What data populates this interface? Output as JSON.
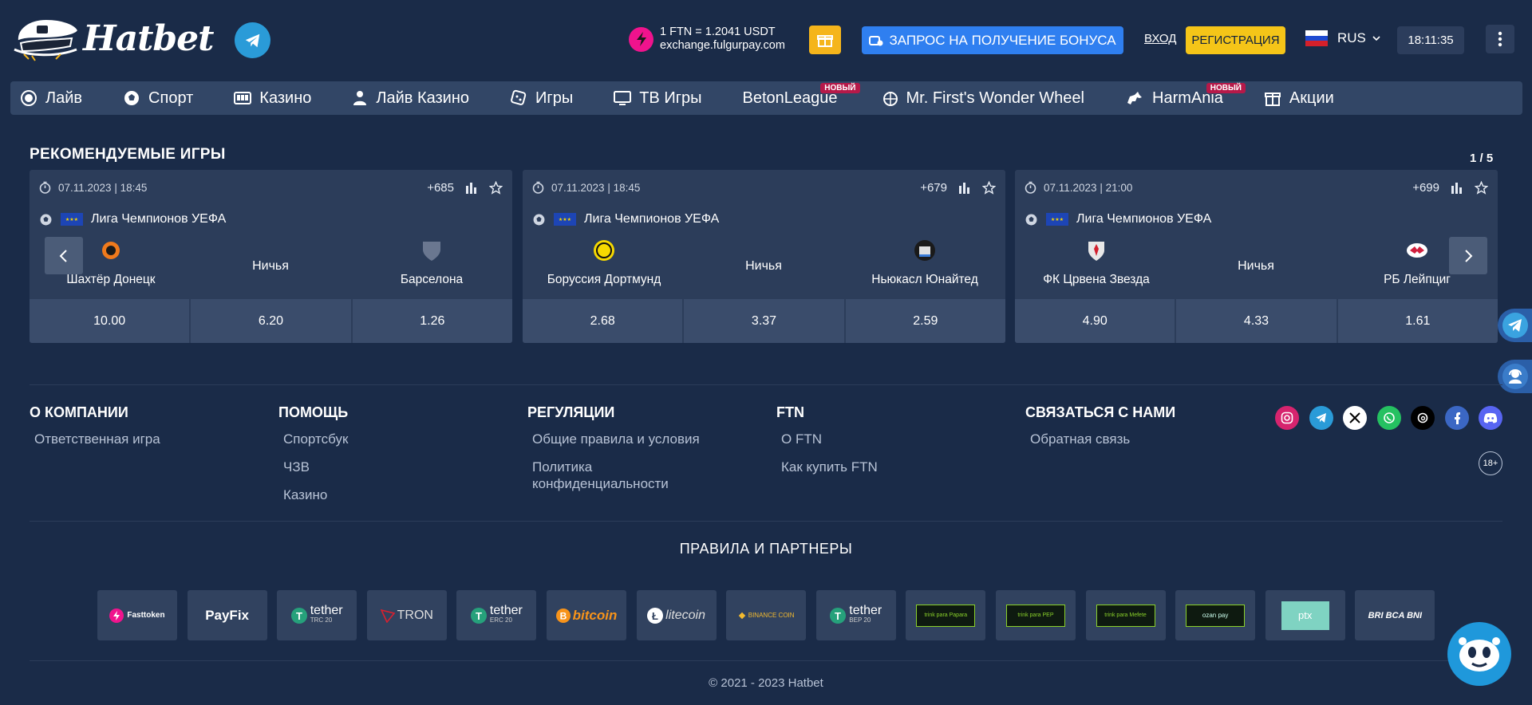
{
  "header": {
    "brand": "Hatbet",
    "exchange_rate": "1 FTN = 1.2041 USDT",
    "exchange_site": "exchange.fulgurpay.com",
    "bonus_label": "ЗАПРОС НА ПОЛУЧЕНИЕ БОНУСА",
    "login_label": "ВХОД",
    "register_label": "РЕГИСТРАЦИЯ",
    "language": "RUS",
    "time": "18:11:35"
  },
  "nav": {
    "items": [
      {
        "label": "Лайв",
        "icon": "live-icon"
      },
      {
        "label": "Спорт",
        "icon": "soccer-ball-icon"
      },
      {
        "label": "Казино",
        "icon": "slot-machine-icon"
      },
      {
        "label": "Лайв Казино",
        "icon": "dealer-icon"
      },
      {
        "label": "Игры",
        "icon": "dice-icon"
      },
      {
        "label": "ТВ Игры",
        "icon": "tv-icon"
      },
      {
        "label": "BetonLeague",
        "badge": "НОВЫЙ"
      },
      {
        "label": "Mr. First's Wonder Wheel",
        "icon": "wheel-icon"
      },
      {
        "label": "HarmAnia",
        "badge": "НОВЫЙ",
        "icon": "horse-icon"
      },
      {
        "label": "Акции",
        "icon": "gift-icon"
      }
    ]
  },
  "featured": {
    "title": "РЕКОМЕНДУЕМЫЕ ИГРЫ",
    "pager": "1 / 5",
    "cards": [
      {
        "date": "07.11.2023 | 18:45",
        "count": "+685",
        "league": "Лига Чемпионов УЕФА",
        "home": "Шахтёр Донецк",
        "draw": "Ничья",
        "away": "Барселона",
        "odds": [
          "10.00",
          "6.20",
          "1.26"
        ]
      },
      {
        "date": "07.11.2023 | 18:45",
        "count": "+679",
        "league": "Лига Чемпионов УЕФА",
        "home": "Боруссия Дортмунд",
        "draw": "Ничья",
        "away": "Ньюкасл Юнайтед",
        "odds": [
          "2.68",
          "3.37",
          "2.59"
        ]
      },
      {
        "date": "07.11.2023 | 21:00",
        "count": "+699",
        "league": "Лига Чемпионов УЕФА",
        "home": "ФК Црвена Звезда",
        "draw": "Ничья",
        "away": "РБ Лейпциг",
        "odds": [
          "4.90",
          "4.33",
          "1.61"
        ]
      }
    ]
  },
  "footer": {
    "company": {
      "title": "О КОМПАНИИ",
      "links": [
        "Ответственная игра"
      ]
    },
    "help": {
      "title": "ПОМОЩЬ",
      "links": [
        "Спортсбук",
        "ЧЗВ",
        "Казино"
      ]
    },
    "regulations": {
      "title": "РЕГУЛЯЦИИ",
      "links": [
        "Общие правила и условия",
        "Политика конфиденциальности"
      ]
    },
    "ftn": {
      "title": "FTN",
      "links": [
        "О FTN",
        "Как купить FTN"
      ]
    },
    "contact": {
      "title": "СВЯЗАТЬСЯ С НАМИ",
      "links": [
        "Обратная связь"
      ]
    },
    "age": "18+",
    "partners_title": "ПРАВИЛА И ПАРТНЕРЫ",
    "partners": [
      "Fasttoken",
      "PayFix",
      "tether",
      "TRON",
      "tether",
      "bitcoin",
      "litecoin",
      "BINANCE COIN",
      "tether",
      "trink para Papara",
      "trink para PEP",
      "trink para Mefete",
      "ozan pay",
      "ptx",
      "BRI BCA BNI"
    ],
    "partner_subs": {
      "tether_trc": "TRC 20",
      "tether_erc": "ERC 20",
      "tether_bep": "BEP 20"
    },
    "copyright": "© 2021 - 2023 Hatbet"
  },
  "colors": {
    "accent_blue": "#2f7ff0",
    "accent_yellow": "#f5c518",
    "badge_red": "#b61949",
    "bg": "#1a2b48"
  }
}
